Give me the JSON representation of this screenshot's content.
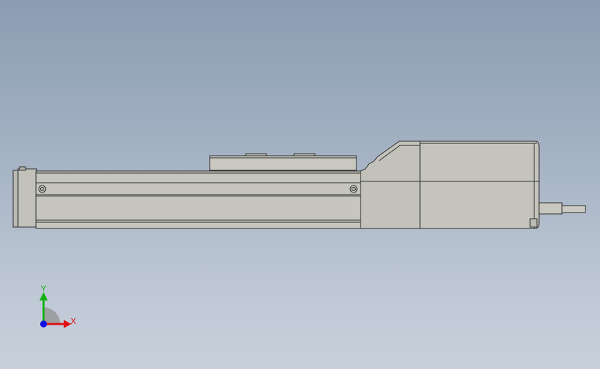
{
  "viewport": {
    "background_top": "#8a9db2",
    "background_bottom": "#c9d0dc",
    "part_fill": "#c4c4bc",
    "part_stroke": "#2b2b2b"
  },
  "triad": {
    "x_label": "X",
    "y_label": "Y",
    "x_color": "#e01010",
    "y_color": "#10b010",
    "z_color": "#1010e0"
  }
}
